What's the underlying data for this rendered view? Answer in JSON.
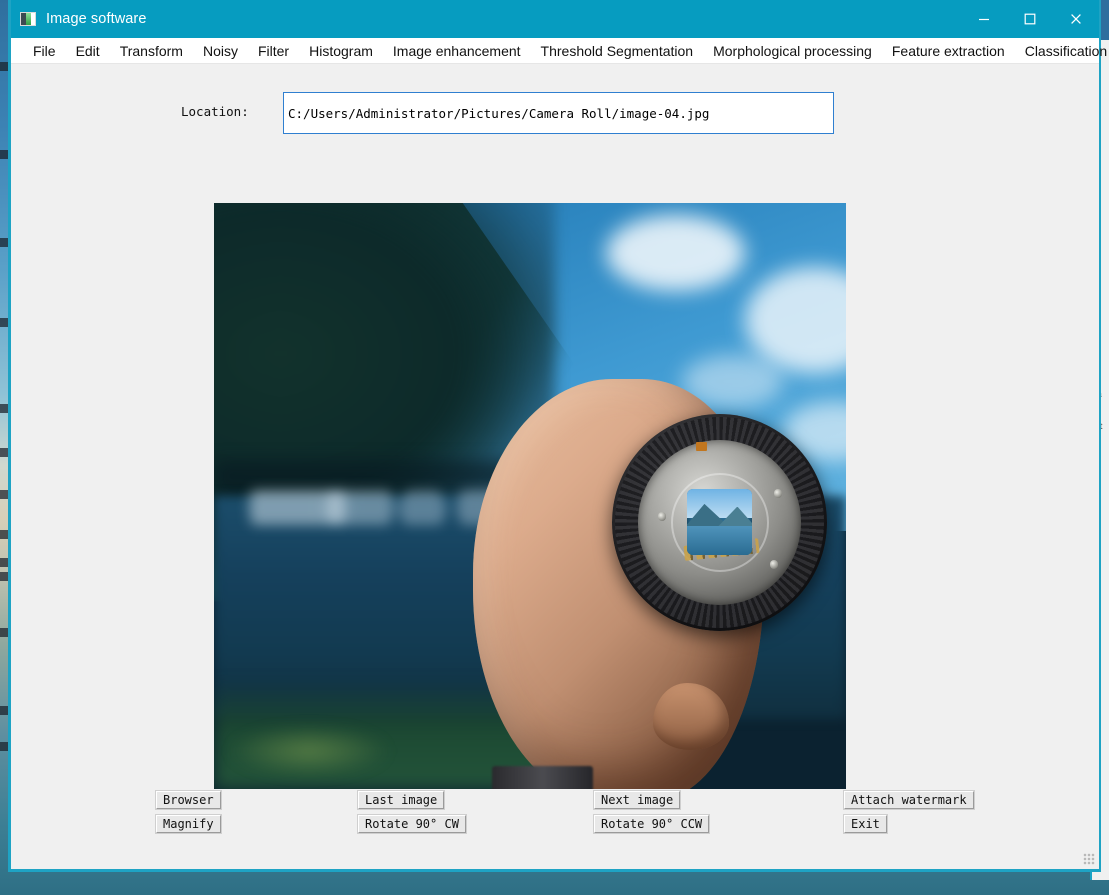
{
  "window": {
    "title": "Image software",
    "icon": "image-file-icon",
    "titlebar_color": "#069cc0",
    "border_color": "#1ea3c4",
    "controls": {
      "minimize": "minimize-icon",
      "maximize": "maximize-icon",
      "close": "close-icon"
    }
  },
  "menubar": {
    "items": [
      {
        "label": "File"
      },
      {
        "label": "Edit"
      },
      {
        "label": "Transform"
      },
      {
        "label": "Noisy"
      },
      {
        "label": "Filter"
      },
      {
        "label": "Histogram"
      },
      {
        "label": "Image enhancement"
      },
      {
        "label": "Threshold Segmentation"
      },
      {
        "label": "Morphological processing"
      },
      {
        "label": "Feature extraction"
      },
      {
        "label": "Classification and recognition"
      }
    ]
  },
  "location": {
    "label": "Location:",
    "value": "C:/Users/Administrator/Pictures/Camera Roll/image-04.jpg",
    "placeholder": "C:/Users/Administrator/Pictures/Camera Roll/image-04.jpg",
    "border_color": "#2f7fd0"
  },
  "preview": {
    "alt": "Hand holding a camera lens mount in front of a blurred mountain lake",
    "frame_color": "#0b2230"
  },
  "buttons": {
    "browser": "Browser",
    "magnify": "Magnify",
    "last_image": "Last image",
    "rotate_cw": "Rotate 90° CW",
    "next_image": "Next image",
    "rotate_ccw": "Rotate 90°  CCW",
    "attach_watermark": "Attach watermark",
    "exit": "Exit"
  }
}
